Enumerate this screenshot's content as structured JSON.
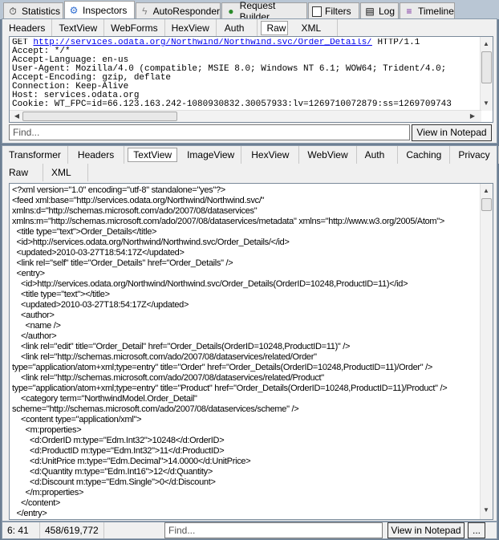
{
  "top_tabs": [
    {
      "label": "Statistics",
      "icon": "stopwatch-icon"
    },
    {
      "label": "Inspectors",
      "icon": "inspector-icon"
    },
    {
      "label": "AutoResponder",
      "icon": "lightning-icon"
    },
    {
      "label": "Request Builder",
      "icon": "globe-icon"
    },
    {
      "label": "Filters",
      "icon": "checkbox-icon"
    },
    {
      "label": "Log",
      "icon": "log-icon"
    },
    {
      "label": "Timeline",
      "icon": "timeline-icon"
    }
  ],
  "request": {
    "tabs": [
      "Headers",
      "TextView",
      "WebForms",
      "HexView",
      "Auth",
      "Raw",
      "XML"
    ],
    "selected_tab": "Raw",
    "method": "GET",
    "url": "http://services.odata.org/Northwind/Northwind.svc/Order_Details/",
    "protocol": "HTTP/1.1",
    "lines": [
      "Accept: */*",
      "Accept-Language: en-us",
      "User-Agent: Mozilla/4.0 (compatible; MSIE 8.0; Windows NT 6.1; WOW64; Trident/4.0;",
      "Accept-Encoding: gzip, deflate",
      "Connection: Keep-Alive",
      "Host: services.odata.org",
      "Cookie: WT_FPC=id=66.123.163.242-1080930832.30057933:lv=1269710072879:ss=1269709743"
    ],
    "find_placeholder": "Find...",
    "notepad_label": "View in Notepad"
  },
  "response": {
    "tabs_row1": [
      "Transformer",
      "Headers",
      "TextView",
      "ImageView",
      "HexView",
      "WebView",
      "Auth",
      "Caching",
      "Privacy"
    ],
    "tabs_row2": [
      "Raw",
      "XML"
    ],
    "selected_tab": "TextView",
    "lines": [
      "<?xml version=\"1.0\" encoding=\"utf-8\" standalone=\"yes\"?>",
      "<feed xml:base=\"http://services.odata.org/Northwind/Northwind.svc/\"",
      "xmlns:d=\"http://schemas.microsoft.com/ado/2007/08/dataservices\"",
      "xmlns:m=\"http://schemas.microsoft.com/ado/2007/08/dataservices/metadata\" xmlns=\"http://www.w3.org/2005/Atom\">",
      "  <title type=\"text\">Order_Details</title>",
      "  <id>http://services.odata.org/Northwind/Northwind.svc/Order_Details/</id>",
      "  <updated>2010-03-27T18:54:17Z</updated>",
      "  <link rel=\"self\" title=\"Order_Details\" href=\"Order_Details\" />",
      "  <entry>",
      "    <id>http://services.odata.org/Northwind/Northwind.svc/Order_Details(OrderID=10248,ProductID=11)</id>",
      "    <title type=\"text\"></title>",
      "    <updated>2010-03-27T18:54:17Z</updated>",
      "    <author>",
      "      <name />",
      "    </author>",
      "    <link rel=\"edit\" title=\"Order_Detail\" href=\"Order_Details(OrderID=10248,ProductID=11)\" />",
      "    <link rel=\"http://schemas.microsoft.com/ado/2007/08/dataservices/related/Order\"",
      "type=\"application/atom+xml;type=entry\" title=\"Order\" href=\"Order_Details(OrderID=10248,ProductID=11)/Order\" />",
      "    <link rel=\"http://schemas.microsoft.com/ado/2007/08/dataservices/related/Product\"",
      "type=\"application/atom+xml;type=entry\" title=\"Product\" href=\"Order_Details(OrderID=10248,ProductID=11)/Product\" />",
      "    <category term=\"NorthwindModel.Order_Detail\"",
      "scheme=\"http://schemas.microsoft.com/ado/2007/08/dataservices/scheme\" />",
      "    <content type=\"application/xml\">",
      "      <m:properties>",
      "        <d:OrderID m:type=\"Edm.Int32\">10248</d:OrderID>",
      "        <d:ProductID m:type=\"Edm.Int32\">11</d:ProductID>",
      "        <d:UnitPrice m:type=\"Edm.Decimal\">14.0000</d:UnitPrice>",
      "        <d:Quantity m:type=\"Edm.Int16\">12</d:Quantity>",
      "        <d:Discount m:type=\"Edm.Single\">0</d:Discount>",
      "      </m:properties>",
      "    </content>",
      "  </entry>"
    ],
    "status_position": "6: 41",
    "status_count": "458/619,772",
    "find_placeholder": "Find...",
    "notepad_label": "View in Notepad",
    "more_label": "..."
  }
}
